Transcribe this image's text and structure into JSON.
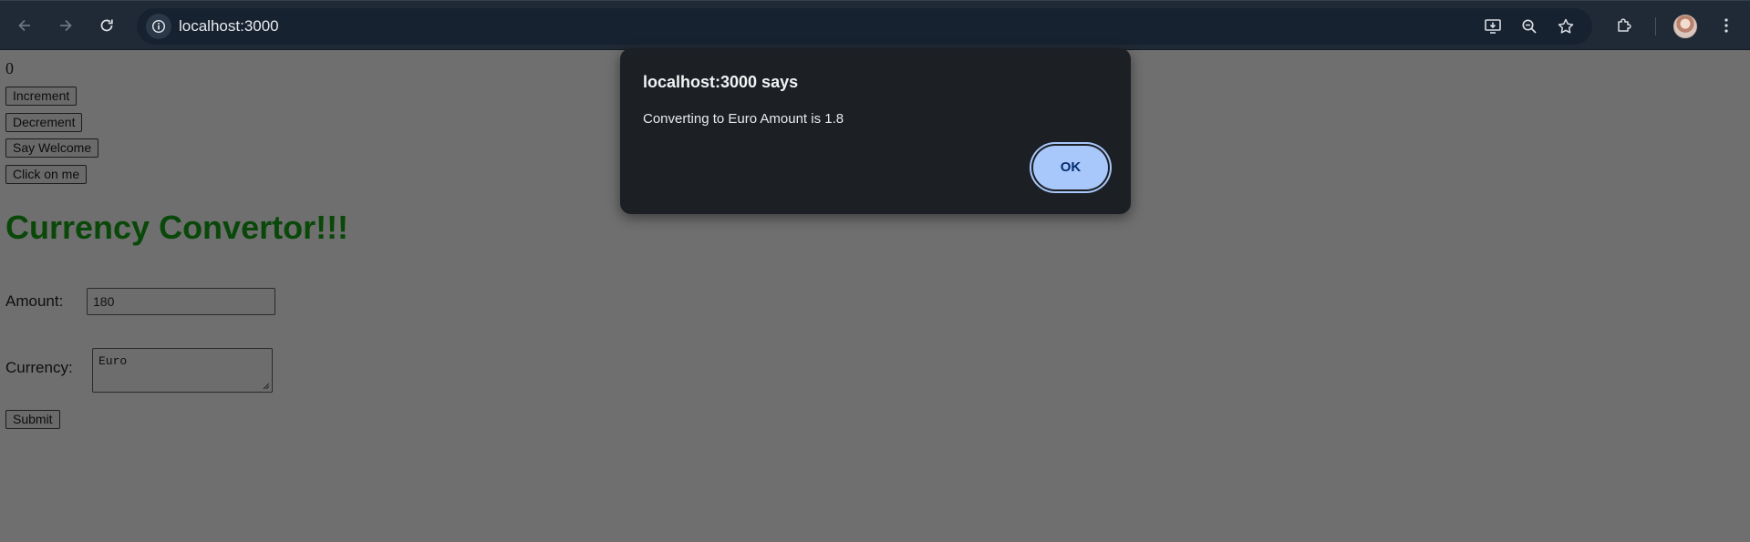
{
  "browser": {
    "url": "localhost:3000",
    "icons": {
      "back": "arrow-left-icon",
      "forward": "arrow-right-icon",
      "reload": "reload-icon",
      "site_info": "info-icon",
      "install_app": "install-app-icon",
      "zoom": "zoom-out-icon",
      "bookmark": "star-icon",
      "extensions": "puzzle-icon",
      "menu": "kebab-menu-icon"
    }
  },
  "page": {
    "counter_value": "0",
    "buttons": {
      "increment": "Increment",
      "decrement": "Decrement",
      "say_welcome": "Say Welcome",
      "click_on_me": "Click on me"
    },
    "heading": "Currency Convertor!!!",
    "form": {
      "amount_label": "Amount:",
      "amount_value": "180",
      "currency_label": "Currency:",
      "currency_value": "Euro",
      "submit_label": "Submit"
    }
  },
  "dialog": {
    "title": "localhost:3000 says",
    "message": "Converting to Euro Amount is 1.8",
    "ok_label": "OK"
  },
  "colors": {
    "heading": "#0a480a",
    "dialog_bg": "#1c1f24",
    "ok_button": "#a8c7fa",
    "overlay_page_bg": "#6f6f6f"
  }
}
